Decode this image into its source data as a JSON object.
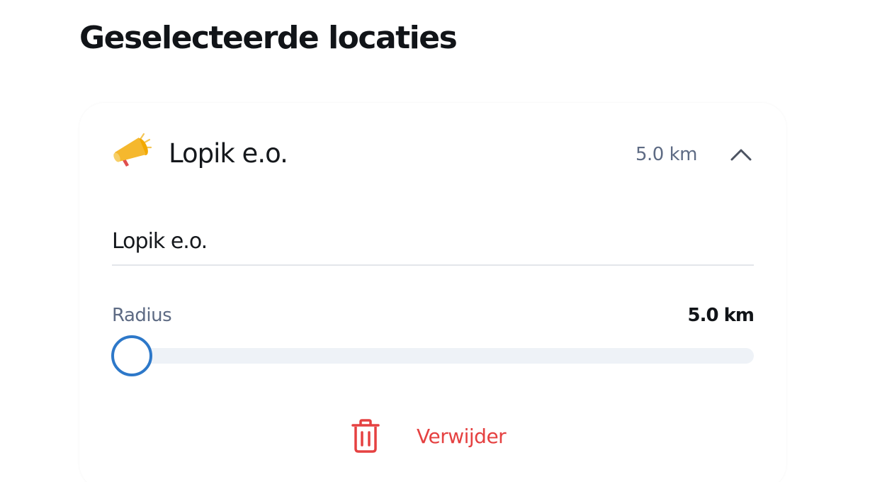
{
  "page": {
    "title": "Geselecteerde locaties"
  },
  "location_card": {
    "icon": "megaphone-icon",
    "header_title": "Lopik e.o.",
    "header_distance": "5.0 km",
    "collapse_icon": "chevron-up-icon",
    "name_field_value": "Lopik e.o.",
    "radius": {
      "label": "Radius",
      "value_text": "5.0 km",
      "fill_fraction": 0.0
    },
    "delete": {
      "icon": "trash-icon",
      "label": "Verwijder"
    }
  },
  "colors": {
    "title_text": "#111418",
    "muted_text": "#5e6b84",
    "slider_thumb": "#2d78c9",
    "slider_track": "#eef2f7",
    "danger": "#e54141",
    "megaphone_body": "#f5b82e",
    "megaphone_handle": "#e04e4e"
  }
}
